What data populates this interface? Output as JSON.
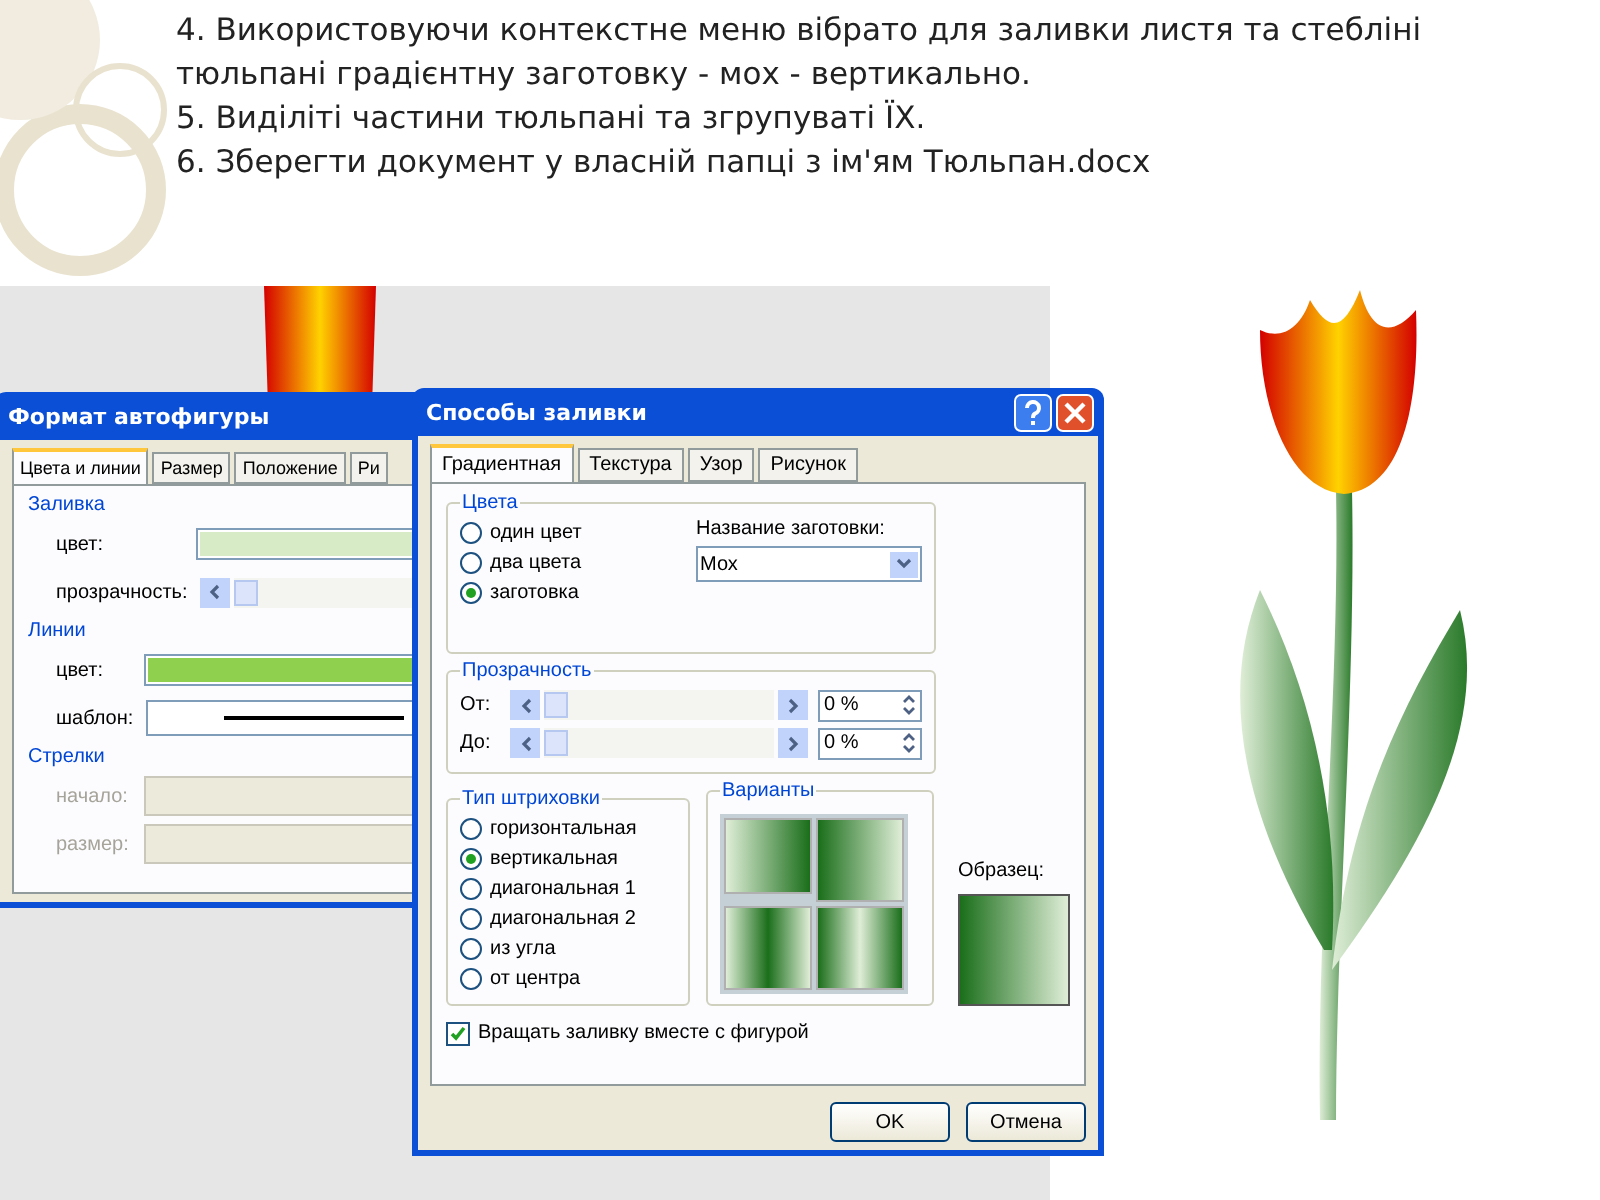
{
  "instructions": [
    "4. Використовуючи контекстне меню вібрато для заливки листя та стебліні тюльпані градієнтну заготовку - мох - вертикально.",
    "5. Виділіті частини тюльпані та згрупуваті ЇХ.",
    "6. Зберегти документ у власній папці з ім'ям Тюльпан.docx"
  ],
  "back_dialog": {
    "title": "Формат автофигуры",
    "tabs": [
      {
        "label": "Цвета и линии",
        "selected": true
      },
      {
        "label": "Размер",
        "selected": false
      },
      {
        "label": "Положение",
        "selected": false
      },
      {
        "label": "Ри",
        "selected": false
      }
    ],
    "fill": {
      "heading": "Заливка",
      "color_label": "цвет:",
      "transparency_label": "прозрачность:",
      "transparency_slider": {
        "level": 0
      }
    },
    "lines": {
      "heading": "Линии",
      "color_label": "цвет:",
      "pattern_label": "шаблон:"
    },
    "arrows": {
      "heading": "Стрелки",
      "fields": [
        {
          "label": "начало:",
          "disabled": true
        },
        {
          "label": "размер:",
          "disabled": true
        }
      ]
    }
  },
  "front_dialog": {
    "title": "Способы заливки",
    "tabs": [
      {
        "label": "Градиентная",
        "selected": true
      },
      {
        "label": "Текстура",
        "selected": false
      },
      {
        "label": "Узор",
        "selected": false
      },
      {
        "label": "Рисунок",
        "selected": false
      }
    ],
    "colors": {
      "heading": "Цвета",
      "options": [
        {
          "label": "один цвет",
          "selected": false
        },
        {
          "label": "два цвета",
          "selected": false
        },
        {
          "label": "заготовка",
          "selected": true
        }
      ],
      "preset_label": "Название заготовки:",
      "preset_value": "Мох"
    },
    "transparency": {
      "heading": "Прозрачность",
      "rows": [
        {
          "label": "От:",
          "value": "0 %",
          "level": 0
        },
        {
          "label": "До:",
          "value": "0 %",
          "level": 0
        }
      ]
    },
    "shading": {
      "heading": "Тип штриховки",
      "options": [
        {
          "label": "горизонтальная",
          "selected": false
        },
        {
          "label": "вертикальная",
          "selected": true
        },
        {
          "label": "диагональная 1",
          "selected": false
        },
        {
          "label": "диагональная 2",
          "selected": false
        },
        {
          "label": "из угла",
          "selected": false
        },
        {
          "label": "от центра",
          "selected": false
        }
      ]
    },
    "variants": {
      "heading": "Варианты"
    },
    "sample_label": "Образец:",
    "rotate": {
      "label": "Вращать заливку вместе с фигурой",
      "checked": true
    },
    "buttons": [
      "OK",
      "Отмена"
    ]
  }
}
